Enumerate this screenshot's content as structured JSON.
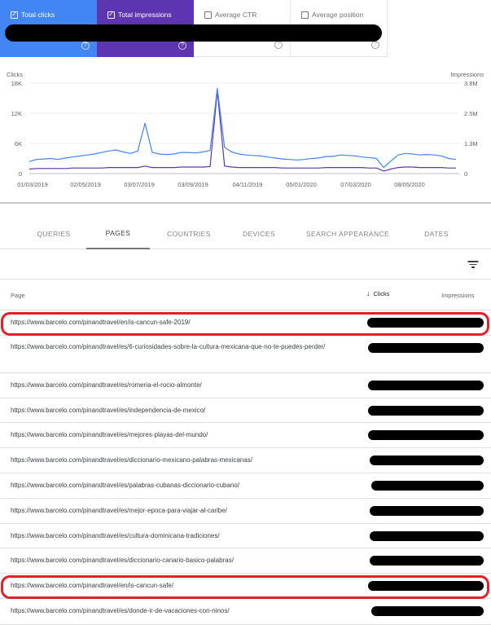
{
  "metrics": [
    {
      "label": "Total clicks",
      "checked": true
    },
    {
      "label": "Total impressions",
      "checked": true
    },
    {
      "label": "Average CTR",
      "checked": false
    },
    {
      "label": "Average position",
      "checked": false
    }
  ],
  "help_glyph": "?",
  "chart_data": {
    "type": "line",
    "left_axis": {
      "label": "Clicks",
      "ticks": [
        "18K",
        "12K",
        "6K",
        "0"
      ],
      "values": [
        18000,
        12000,
        6000,
        0
      ]
    },
    "right_axis": {
      "label": "Impressions",
      "ticks": [
        "3.8M",
        "2.5M",
        "1.3M",
        "0"
      ],
      "values": [
        3800000,
        2500000,
        1300000,
        0
      ]
    },
    "x_ticks": [
      "01/03/2019",
      "02/05/2019",
      "03/07/2019",
      "03/09/2019",
      "04/11/2019",
      "05/01/2020",
      "07/03/2020",
      "08/05/2020"
    ],
    "series": [
      {
        "name": "Total clicks",
        "color": "#4285f4",
        "axis": "left",
        "values": [
          2400,
          2800,
          2900,
          3000,
          2800,
          3100,
          3300,
          3500,
          3700,
          3900,
          4200,
          4500,
          4700,
          4300,
          4000,
          4500,
          10000,
          4200,
          3900,
          3800,
          3900,
          4200,
          4200,
          4100,
          4300,
          4600,
          17000,
          5200,
          4300,
          3900,
          3700,
          3600,
          3500,
          3300,
          3100,
          2900,
          2800,
          2700,
          2800,
          3000,
          3100,
          3400,
          3400,
          3700,
          3600,
          3500,
          3300,
          3200,
          3000,
          1200,
          2500,
          3700,
          4000,
          3900,
          3700,
          3800,
          3700,
          3500,
          3000,
          2800
        ]
      },
      {
        "name": "Total impressions",
        "color": "#5e35b1",
        "axis": "left",
        "values": [
          900,
          1000,
          1000,
          1000,
          1000,
          1000,
          1100,
          1100,
          1100,
          1100,
          1100,
          1200,
          1200,
          1200,
          1200,
          1200,
          1500,
          1200,
          1200,
          1200,
          1200,
          1300,
          1300,
          1300,
          1300,
          1400,
          16500,
          1500,
          1300,
          1200,
          1200,
          1200,
          1200,
          1200,
          1200,
          1100,
          1100,
          1100,
          1100,
          1100,
          1100,
          1200,
          1200,
          1200,
          1200,
          1200,
          1200,
          1100,
          1100,
          500,
          900,
          1200,
          1300,
          1300,
          1200,
          1200,
          1200,
          1200,
          1100,
          1100
        ]
      }
    ],
    "ylim": [
      0,
      18000
    ],
    "grid": true
  },
  "tabs": [
    {
      "label": "QUERIES",
      "active": false
    },
    {
      "label": "PAGES",
      "active": true
    },
    {
      "label": "COUNTRIES",
      "active": false
    },
    {
      "label": "DEVICES",
      "active": false
    },
    {
      "label": "SEARCH APPEARANCE",
      "active": false
    },
    {
      "label": "DATES",
      "active": false
    }
  ],
  "table": {
    "columns": {
      "page": "Page",
      "clicks": "Clicks",
      "impressions": "Impressions"
    },
    "sort_arrow": "↓",
    "rows": [
      {
        "url": "https://www.barcelo.com/pinandtravel/en/is-cancun-safe-2019/",
        "highlighted": true
      },
      {
        "url": "https://www.barcelo.com/pinandtravel/es/6-curiosidades-sobre-la-cultura-mexicana-que-no-te-puedes-perder/",
        "highlighted": false
      },
      {
        "url": "https://www.barcelo.com/pinandtravel/es/romeria-el-rocio-almonte/",
        "highlighted": false
      },
      {
        "url": "https://www.barcelo.com/pinandtravel/es/independencia-de-mexico/",
        "highlighted": false
      },
      {
        "url": "https://www.barcelo.com/pinandtravel/es/mejores-playas-del-mundo/",
        "highlighted": false
      },
      {
        "url": "https://www.barcelo.com/pinandtravel/es/diccionario-mexicano-palabras-mexicanas/",
        "highlighted": false
      },
      {
        "url": "https://www.barcelo.com/pinandtravel/es/palabras-cubanas-diccionario-cubano/",
        "highlighted": false
      },
      {
        "url": "https://www.barcelo.com/pinandtravel/es/mejor-epoca-para-viajar-al-caribe/",
        "highlighted": false
      },
      {
        "url": "https://www.barcelo.com/pinandtravel/es/cultura-dominicana-tradiciones/",
        "highlighted": false
      },
      {
        "url": "https://www.barcelo.com/pinandtravel/es/diccionario-canario-basico-palabras/",
        "highlighted": false
      },
      {
        "url": "https://www.barcelo.com/pinandtravel/en/is-cancun-safe/",
        "highlighted": true
      },
      {
        "url": "https://www.barcelo.com/pinandtravel/es/donde-ir-de-vacaciones-con-ninos/",
        "highlighted": false
      }
    ]
  },
  "colors": {
    "clicks": "#4285f4",
    "impressions": "#5e35b1",
    "highlight": "#e0202b"
  }
}
